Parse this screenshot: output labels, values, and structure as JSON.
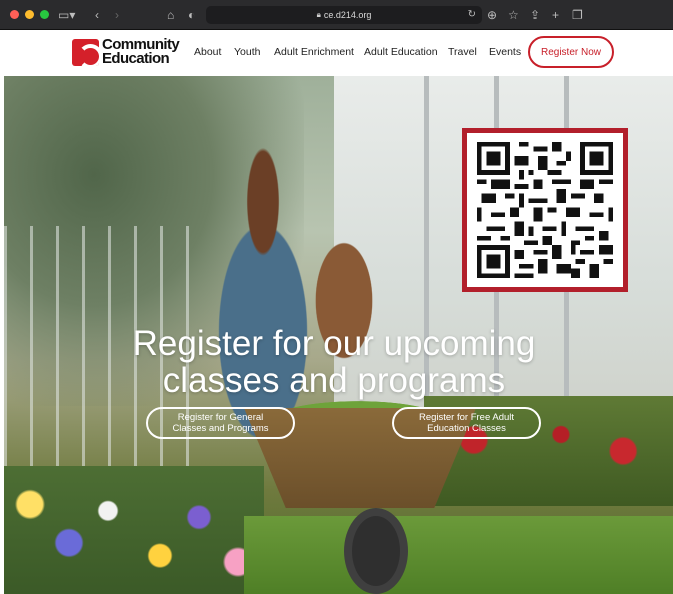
{
  "browser": {
    "url": "ce.d214.org",
    "icons": {
      "sidebar": "sidebar-toggle-icon",
      "back": "chevron-left-icon",
      "forward": "chevron-right-icon",
      "home": "home-icon",
      "shield": "privacy-shield-icon",
      "lock": "lock-icon",
      "reload": "reload-icon",
      "download": "download-icon",
      "bookmark": "star-icon",
      "share": "share-icon",
      "new_tab": "plus-icon",
      "tabs": "tab-overview-icon"
    }
  },
  "site": {
    "logo": {
      "line1": "Community",
      "line2": "Education"
    },
    "nav": {
      "links": [
        "About",
        "Youth",
        "Adult Enrichment",
        "Adult Education",
        "Travel",
        "Events"
      ],
      "cta": "Register Now"
    },
    "hero": {
      "title_line1": "Register for our upcoming",
      "title_line2": "classes and programs",
      "buttons": [
        {
          "line1": "Register for General",
          "line2": "Classes and Programs"
        },
        {
          "line1": "Register for Free Adult",
          "line2": "Education Classes"
        }
      ]
    }
  },
  "colors": {
    "brand_red": "#c8202a",
    "qr_border": "#b21f2b",
    "chrome_bg": "#2b2b2d"
  }
}
